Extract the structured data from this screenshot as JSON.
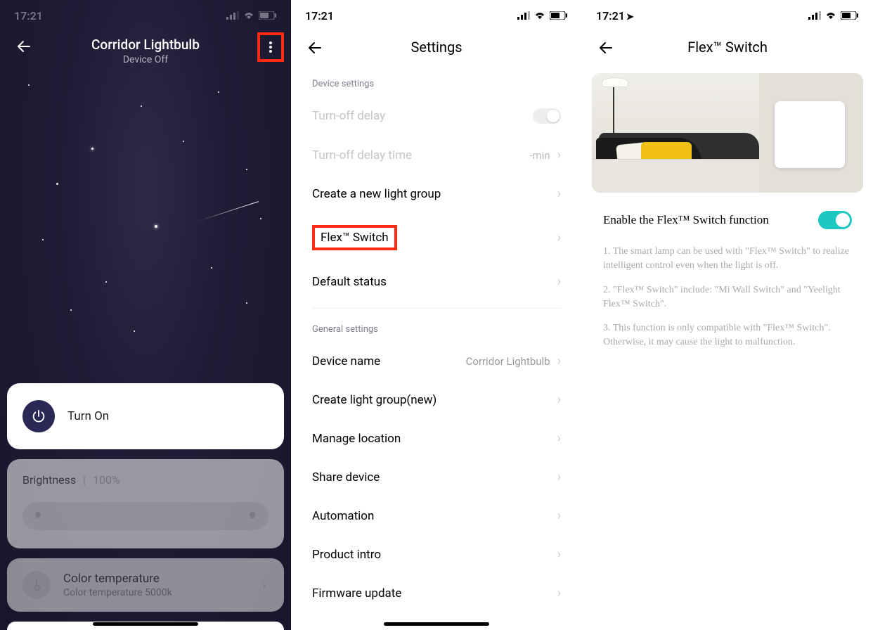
{
  "status": {
    "time": "17:21"
  },
  "screen1": {
    "title": "Corridor Lightbulb",
    "subtitle": "Device Off",
    "turn_on": "Turn On",
    "brightness_label": "Brightness",
    "brightness_value": "100%",
    "color_temp_title": "Color temperature",
    "color_temp_value": "Color temperature 5000k"
  },
  "screen2": {
    "title": "Settings",
    "section_device": "Device settings",
    "rows_device": {
      "turn_off_delay": "Turn-off delay",
      "turn_off_delay_time": "Turn-off delay time",
      "turn_off_delay_time_value": "-min",
      "create_group": "Create a new light group",
      "flex_switch": "Flex™ Switch",
      "default_status": "Default status"
    },
    "section_general": "General settings",
    "rows_general": {
      "device_name": "Device name",
      "device_name_value": "Corridor Lightbulb",
      "create_group_new": "Create light group(new)",
      "manage_location": "Manage location",
      "share_device": "Share device",
      "automation": "Automation",
      "product_intro": "Product intro",
      "firmware_update": "Firmware update"
    }
  },
  "screen3": {
    "title": "Flex™ Switch",
    "enable_label": "Enable the Flex™ Switch function",
    "enable_on": true,
    "notes": [
      "1. The smart lamp can be used with \"Flex™ Switch\" to realize intelligent control even when the light is off.",
      "2. \"Flex™ Switch\" include: \"Mi Wall Switch\" and \"Yeelight Flex™ Switch\".",
      "3. This function is only compatible with \"Flex™ Switch\". Otherwise, it may cause the light to malfunction."
    ]
  }
}
